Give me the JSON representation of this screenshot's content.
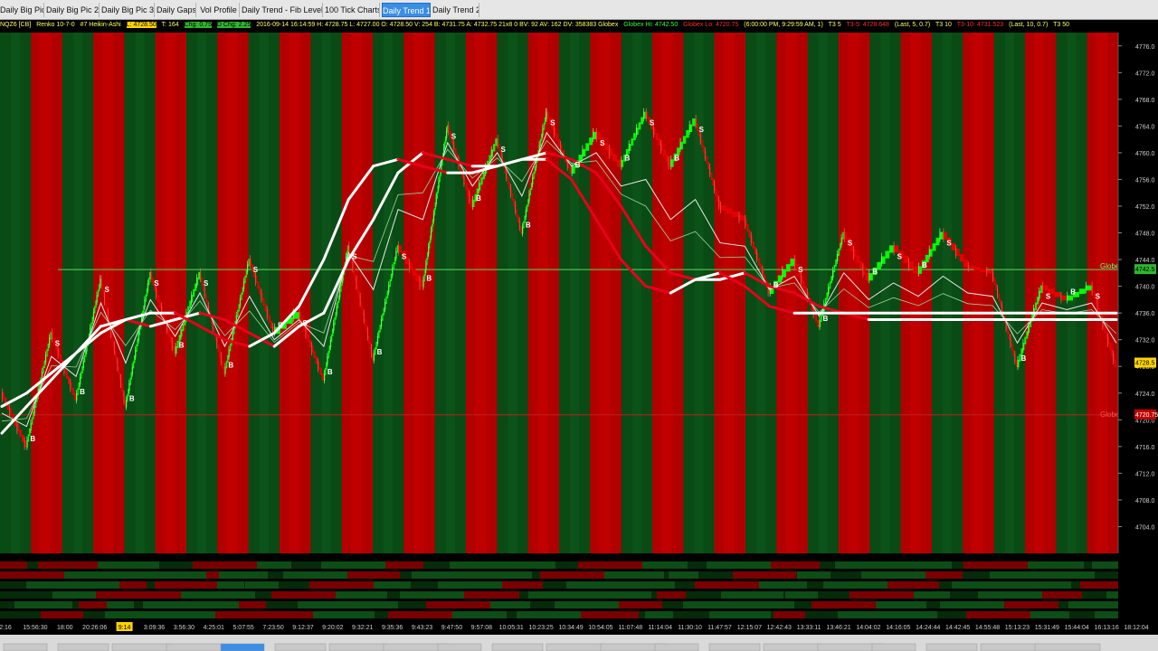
{
  "tabs": [
    {
      "label": "Daily Big Pic",
      "active": false
    },
    {
      "label": "Daily Big Pic 2",
      "active": false
    },
    {
      "label": "Daily Big Pic 3",
      "active": false
    },
    {
      "label": "Daily Gaps",
      "active": false
    },
    {
      "label": "Vol Profile",
      "active": false
    },
    {
      "label": "Daily Trend - Fib Levels",
      "active": false
    },
    {
      "label": "100 Tick Charts",
      "active": false
    },
    {
      "label": "Daily Trend 1",
      "active": true
    },
    {
      "label": "Daily Trend 2",
      "active": false
    }
  ],
  "info": {
    "symbol": "NQZ6 [CB]",
    "bars": "Renko 10-7-0",
    "study": "#7 Heikin-Ashi",
    "last": "L: 4728.50",
    "tick": "T: 164",
    "chg1": "Chg: 0.75",
    "chg2": "D Chg: 2.25",
    "ohlc": "2016-09-14 16:14:59 H: 4728.75 L: 4727.00 O: 4728.50 V: 254 B: 4731.75 A: 4732.75 21x8 0 BV: 92 AV: 162 DV: 358383 Globex",
    "globex_hi": "Globex Hi: 4742.50",
    "globex_lo": "Globex Lo: 4720.75",
    "session": "(6:00:00 PM, 9:29:59 AM, 1)",
    "t3a": "T3 5",
    "t3b": "T3-5: 4728.648",
    "last2": "(Last, 5, 0.7)",
    "t3c": "T3 10",
    "t3d": "T3-10: 4731.523",
    "last3": "(Last, 10, 0.7)",
    "t3e": "T3 50"
  },
  "colors": {
    "up": "#00ff00",
    "down": "#e60000",
    "bg_up": "#0a4a14",
    "bg_down": "#b20000",
    "fast_ma": "#ffffff",
    "slow_ma": "#e8001a"
  },
  "chart_data": {
    "type": "line",
    "title": "NQZ6 [CB] Renko 10-7-0 #7 Heikin-Ashi",
    "ylim": [
      4700,
      4778
    ],
    "y_ticks": [
      4776,
      4772,
      4768,
      4764,
      4760,
      4756,
      4752,
      4748,
      4744,
      4740,
      4736,
      4732,
      4728,
      4724,
      4720,
      4716,
      4712,
      4708,
      4704
    ],
    "current_price": "4728.5",
    "globex_hi": {
      "value": 4742.5,
      "label": "Globex Hi",
      "tag": "4742.5"
    },
    "globex_lo": {
      "value": 4720.75,
      "label": "Globex Lo",
      "tag": "4720.75"
    },
    "x_labels": [
      "2:16",
      "15:56:30",
      "18:00",
      "20:26:06",
      "9:14",
      "3:09:36",
      "3:56:30",
      "4:25:01",
      "5:07:55",
      "7:23:50",
      "9:12:37",
      "9:20:02",
      "9:32:21",
      "9:35:36",
      "9:43:23",
      "9:47:50",
      "9:57:08",
      "10:05:31",
      "10:23:25",
      "10:34:49",
      "10:54:05",
      "11:07:48",
      "11:14:04",
      "11:30:10",
      "11:47:57",
      "12:15:07",
      "12:42:43",
      "13:33:11",
      "13:46:21",
      "14:04:02",
      "14:16:05",
      "14:24:44",
      "14:42:45",
      "14:55:48",
      "15:13:23",
      "15:31:49",
      "15:44:04",
      "16:13:16",
      "18:12:04"
    ],
    "x_label_highlight": "9:14",
    "regimes": [
      "up",
      "down",
      "up",
      "down",
      "up",
      "down",
      "up",
      "down",
      "up",
      "down",
      "up",
      "down",
      "up",
      "down",
      "up",
      "down",
      "up",
      "down",
      "up",
      "down",
      "up",
      "down",
      "up",
      "down",
      "up",
      "down",
      "up",
      "down",
      "up",
      "down",
      "up",
      "down",
      "up",
      "down",
      "up",
      "down"
    ],
    "series": [
      {
        "key": "price",
        "values": [
          4724,
          4716,
          4733,
          4723,
          4741,
          4722,
          4742,
          4730,
          4742,
          4727,
          4744,
          4733,
          4736,
          4726,
          4746,
          4729,
          4746,
          4740,
          4764,
          4752,
          4762,
          4748,
          4766,
          4757,
          4763,
          4758,
          4766,
          4758,
          4765,
          4752,
          4750,
          4739,
          4744,
          4734,
          4748,
          4741,
          4746,
          4742,
          4748,
          4743,
          4742,
          4728,
          4740,
          4738,
          4740,
          4728
        ]
      },
      {
        "key": "fast_ma",
        "values": [
          4718,
          4722,
          4726,
          4730,
          4734,
          4735,
          4734,
          4735,
          4736,
          4735,
          4733,
          4731,
          4734,
          4736,
          4744,
          4750,
          4757,
          4760,
          4759,
          4758,
          4758,
          4759,
          4760,
          4759,
          4757,
          4752,
          4746,
          4742,
          4741,
          4741,
          4742,
          4740,
          4739,
          4737,
          4736,
          4735,
          4735,
          4735,
          4735,
          4735,
          4735,
          4735,
          4735,
          4735,
          4735,
          4735
        ]
      },
      {
        "key": "slow_ma",
        "values": [
          4722,
          4724,
          4727,
          4730,
          4733,
          4735,
          4736,
          4736,
          4734,
          4732,
          4731,
          4733,
          4737,
          4744,
          4753,
          4758,
          4759,
          4758,
          4757,
          4757,
          4758,
          4759,
          4759,
          4756,
          4750,
          4744,
          4740,
          4739,
          4741,
          4742,
          4740,
          4737,
          4736,
          4736,
          4736,
          4736,
          4736,
          4736,
          4736,
          4736,
          4736,
          4736,
          4736,
          4736,
          4736,
          4736
        ]
      }
    ],
    "signal_labels": [
      "S",
      "B"
    ]
  },
  "bottom_tabs": [
    "",
    "",
    "",
    "",
    "",
    "",
    "",
    "",
    "",
    "",
    "",
    "",
    "",
    "",
    "",
    "",
    "",
    "",
    "",
    ""
  ]
}
